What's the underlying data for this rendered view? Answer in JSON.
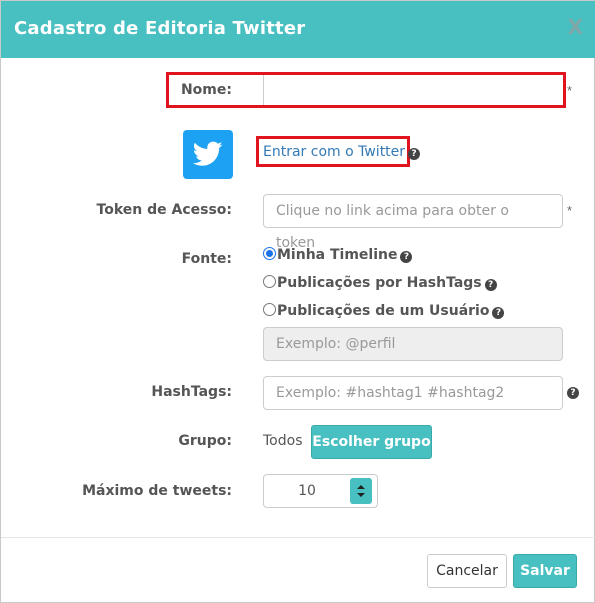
{
  "header": {
    "title": "Cadastro de Editoria Twitter",
    "close": "X"
  },
  "form": {
    "nome": {
      "label": "Nome:",
      "value": "",
      "required": "*"
    },
    "twitter_link": {
      "text": "Entrar com o Twitter",
      "help": "?"
    },
    "token": {
      "label": "Token de Acesso:",
      "placeholder": "Clique no link acima para obter o token",
      "required": "*"
    },
    "fonte": {
      "label": "Fonte:",
      "options": [
        {
          "label": "Minha Timeline",
          "checked": true,
          "help": "?"
        },
        {
          "label": "Publicações por HashTags",
          "checked": false,
          "help": "?"
        },
        {
          "label": "Publicações de um Usuário",
          "checked": false,
          "help": "?"
        }
      ],
      "usuario_placeholder": "Exemplo: @perfil"
    },
    "hashtags": {
      "label": "HashTags:",
      "placeholder": "Exemplo: #hashtag1 #hashtag2",
      "help": "?"
    },
    "grupo": {
      "label": "Grupo:",
      "value": "Todos",
      "button": "Escolher grupo"
    },
    "maximo": {
      "label": "Máximo de tweets:",
      "value": "10"
    }
  },
  "footer": {
    "cancel": "Cancelar",
    "save": "Salvar"
  },
  "colors": {
    "accent": "#48bfc0",
    "twitter": "#1da1f2",
    "highlight": "#e0141e",
    "link": "#337ab7"
  },
  "icons": [
    "twitter-icon",
    "help-icon",
    "close-icon",
    "spinner-up-icon",
    "spinner-down-icon"
  ]
}
